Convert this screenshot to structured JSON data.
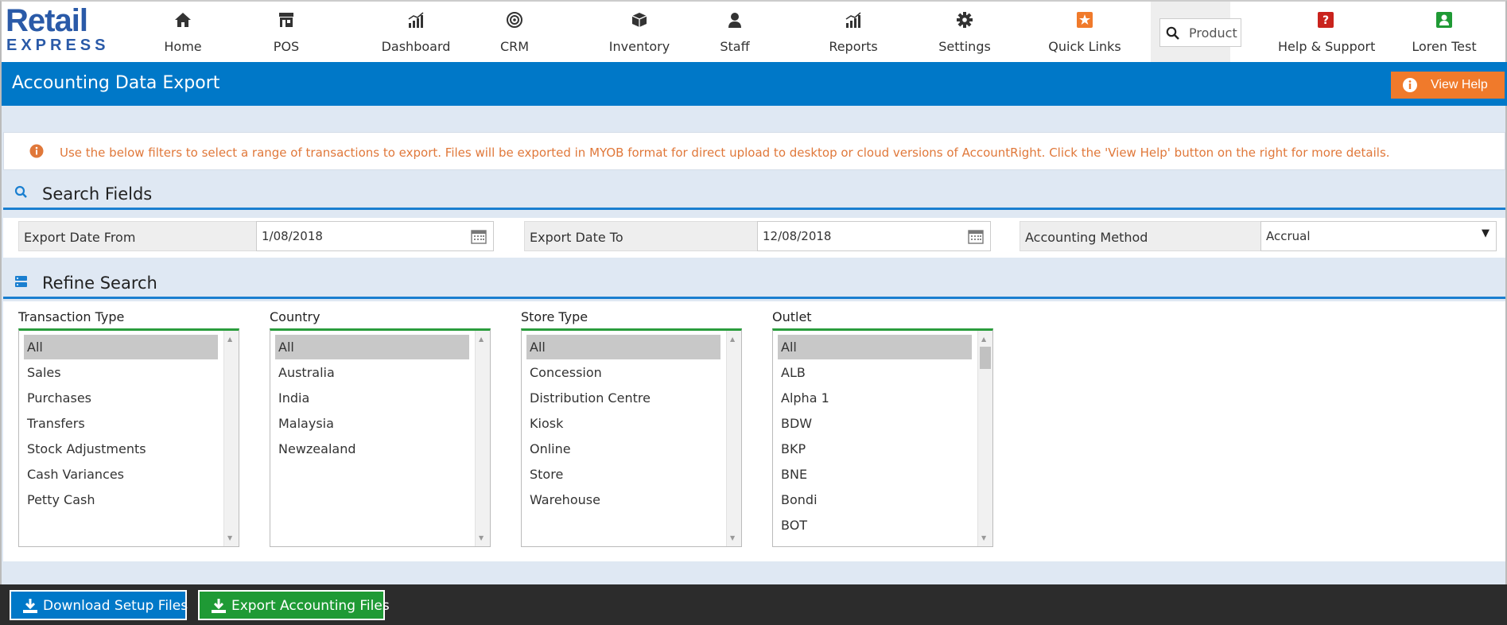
{
  "brand": {
    "line1": "Retail",
    "line2": "EXPRESS"
  },
  "nav": {
    "items": [
      {
        "label": "Home",
        "icon": "home-icon"
      },
      {
        "label": "POS",
        "icon": "store-icon"
      },
      {
        "label": "Dashboard",
        "icon": "bar-chart-icon"
      },
      {
        "label": "CRM",
        "icon": "target-icon"
      },
      {
        "label": "Inventory",
        "icon": "box-icon"
      },
      {
        "label": "Staff",
        "icon": "user-icon"
      },
      {
        "label": "Reports",
        "icon": "bar-chart-icon"
      },
      {
        "label": "Settings",
        "icon": "gear-icon"
      },
      {
        "label": "Quick Links",
        "icon": "star-icon"
      }
    ],
    "search_placeholder": "Product",
    "help_label": "Help & Support",
    "user_label": "Loren Test"
  },
  "page": {
    "title": "Accounting Data Export",
    "view_help_label": "View Help",
    "info_text": "Use the below filters to select a range of transactions to export. Files will be exported in MYOB format for direct upload to desktop or cloud versions of AccountRight. Click the 'View Help' button on the right for more details."
  },
  "search_fields": {
    "heading": "Search Fields",
    "date_from": {
      "label": "Export Date From",
      "value": "1/08/2018"
    },
    "date_to": {
      "label": "Export Date To",
      "value": "12/08/2018"
    },
    "method": {
      "label": "Accounting Method",
      "value": "Accrual"
    }
  },
  "refine": {
    "heading": "Refine Search",
    "lists": [
      {
        "title": "Transaction Type",
        "options": [
          "All",
          "Sales",
          "Purchases",
          "Transfers",
          "Stock Adjustments",
          "Cash Variances",
          "Petty Cash"
        ],
        "selected": "All"
      },
      {
        "title": "Country",
        "options": [
          "All",
          "Australia",
          "India",
          "Malaysia",
          "Newzealand"
        ],
        "selected": "All"
      },
      {
        "title": "Store Type",
        "options": [
          "All",
          "Concession",
          "Distribution Centre",
          "Kiosk",
          "Online",
          "Store",
          "Warehouse"
        ],
        "selected": "All"
      },
      {
        "title": "Outlet",
        "options": [
          "All",
          "ALB",
          "Alpha 1",
          "BDW",
          "BKP",
          "BNE",
          "Bondi",
          "BOT"
        ],
        "selected": "All"
      }
    ]
  },
  "actions": {
    "download_label": "Download Setup Files",
    "export_label": "Export Accounting Files"
  },
  "colors": {
    "header_blue": "#0078c8",
    "help_orange": "#f07a2b",
    "info_text": "#e0783a",
    "export_green": "#1f9a35"
  }
}
